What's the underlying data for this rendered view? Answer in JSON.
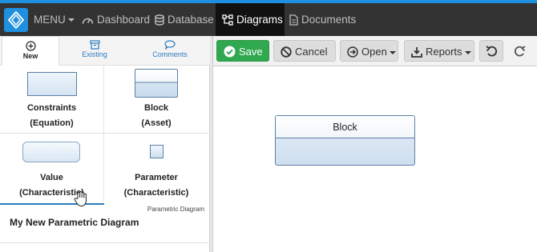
{
  "topbar": {
    "menu_label": "MENU",
    "nav": [
      "Dashboard",
      "Database",
      "Diagrams",
      "Documents"
    ],
    "active": "Diagrams",
    "accent": "#1f8fe0"
  },
  "panel": {
    "tabs": [
      "New",
      "Existing",
      "Comments"
    ],
    "active_tab": "New",
    "tools": [
      {
        "line1": "Constraints",
        "line2": "(Equation)"
      },
      {
        "line1": "Block",
        "line2": "(Asset)"
      },
      {
        "line1": "Value",
        "line2": "(Characteristic)"
      },
      {
        "line1": "Parameter",
        "line2": "(Characteristic)"
      }
    ],
    "diagram_type": "Parametric Diagram",
    "diagram_name": "My New Parametric Diagram"
  },
  "toolbar": {
    "save": "Save",
    "cancel": "Cancel",
    "open": "Open",
    "reports": "Reports",
    "save_color": "#2fa84f"
  },
  "canvas": {
    "block_label": "Block"
  }
}
